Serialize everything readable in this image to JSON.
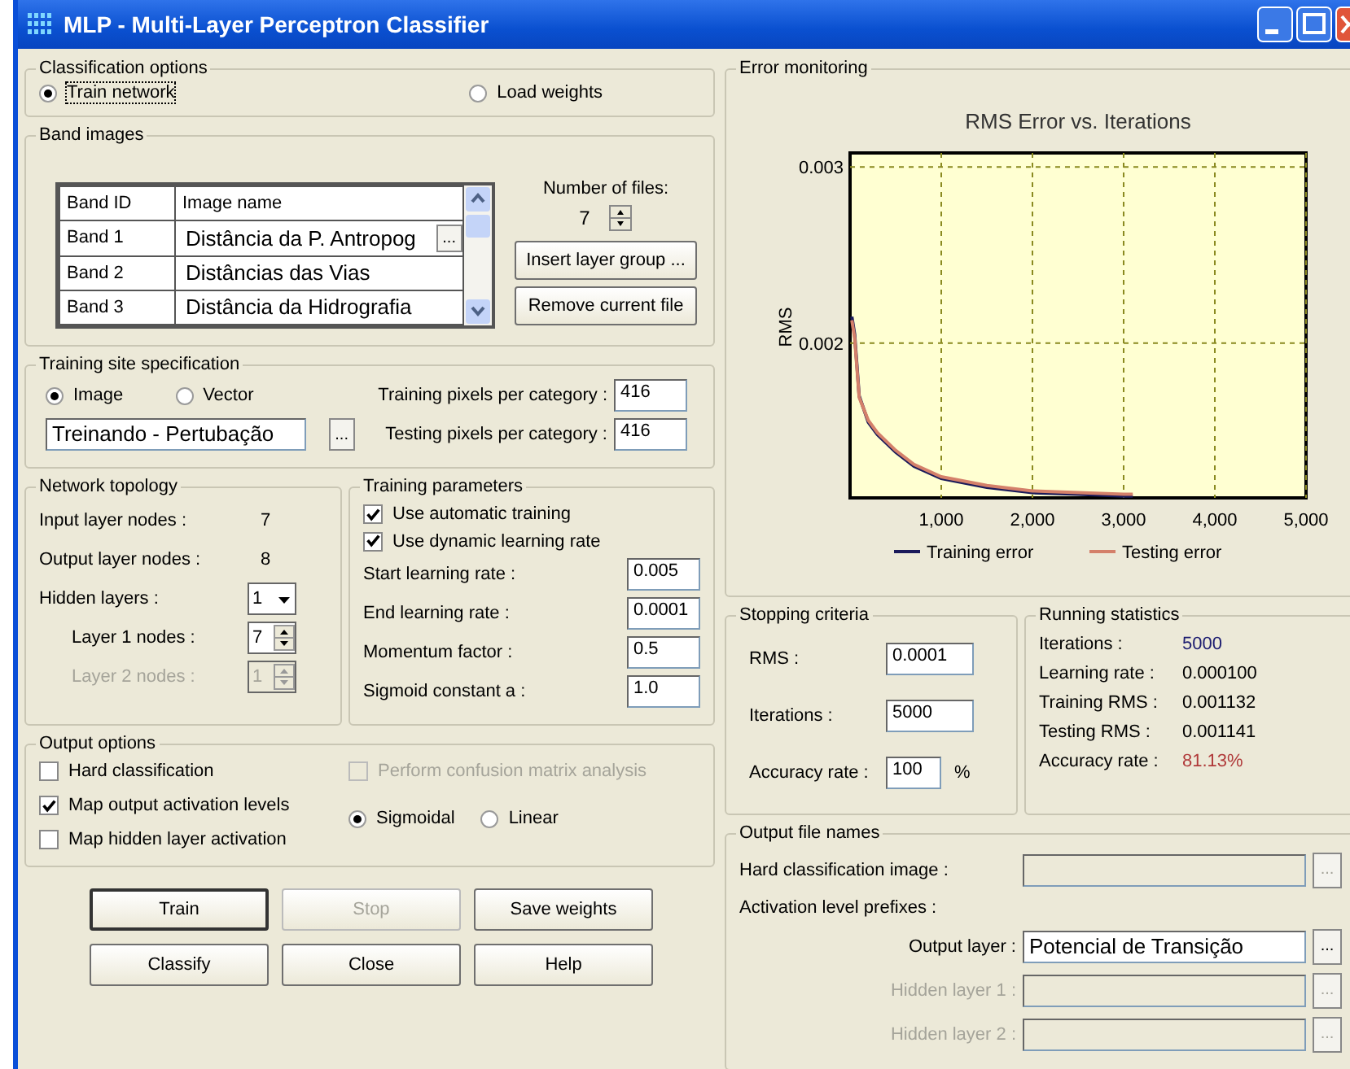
{
  "window": {
    "title": "MLP - Multi-Layer Perceptron Classifier"
  },
  "classification_options": {
    "title": "Classification options",
    "options": [
      {
        "label": "Train network",
        "selected": true
      },
      {
        "label": "Load weights",
        "selected": false
      }
    ]
  },
  "band_images": {
    "title": "Band images",
    "columns": [
      "Band ID",
      "Image name"
    ],
    "rows": [
      {
        "band": "Band 1",
        "image": "Distância da P. Antropog",
        "browse": "..."
      },
      {
        "band": "Band 2",
        "image": "Distâncias das Vias"
      },
      {
        "band": "Band 3",
        "image": "Distância da Hidrografia"
      }
    ],
    "files_label": "Number of files:",
    "files_count": "7",
    "buttons": [
      "Insert layer group ...",
      "Remove current file"
    ]
  },
  "training_site": {
    "title": "Training site specification",
    "options": [
      {
        "label": "Image",
        "selected": true
      },
      {
        "label": "Vector",
        "selected": false
      }
    ],
    "file": "Treinando - Pertubação",
    "browse": "...",
    "fields": [
      {
        "label": "Training pixels per category :",
        "value": "416"
      },
      {
        "label": "Testing pixels per category :",
        "value": "416"
      }
    ]
  },
  "network_topology": {
    "title": "Network topology",
    "rows": [
      {
        "kind": "text",
        "label": "Input layer nodes :",
        "value": "7",
        "disabled": false
      },
      {
        "kind": "text",
        "label": "Output layer nodes :",
        "value": "8",
        "disabled": false
      },
      {
        "kind": "dropdown",
        "label": "Hidden layers :",
        "value": "1",
        "disabled": false
      },
      {
        "kind": "spinner",
        "label": "Layer 1 nodes :",
        "value": "7",
        "disabled": false
      },
      {
        "kind": "spinner",
        "label": "Layer 2 nodes :",
        "value": "1",
        "disabled": true
      }
    ]
  },
  "training_parameters": {
    "title": "Training parameters",
    "checks": [
      {
        "label": "Use automatic training",
        "checked": true
      },
      {
        "label": "Use dynamic learning rate",
        "checked": true
      }
    ],
    "fields": [
      {
        "label": "Start learning rate :",
        "value": "0.005"
      },
      {
        "label": "End learning rate :",
        "value": "0.0001"
      },
      {
        "label": "Momentum factor :",
        "value": "0.5"
      },
      {
        "label": "Sigmoid constant a :",
        "value": "1.0"
      }
    ]
  },
  "output_options": {
    "title": "Output options",
    "checks": [
      {
        "label": "Hard classification",
        "checked": false,
        "disabled": false
      },
      {
        "label": "Map output activation levels",
        "checked": true,
        "disabled": false
      },
      {
        "label": "Map hidden layer activation",
        "checked": false,
        "disabled": false
      },
      {
        "label": "Perform confusion matrix analysis",
        "checked": false,
        "disabled": true
      }
    ],
    "activation": [
      {
        "label": "Sigmoidal",
        "selected": true
      },
      {
        "label": "Linear",
        "selected": false
      }
    ]
  },
  "buttons": [
    {
      "label": "Train",
      "default": true,
      "disabled": false
    },
    {
      "label": "Stop",
      "default": false,
      "disabled": true
    },
    {
      "label": "Save weights",
      "default": false,
      "disabled": false
    },
    {
      "label": "Classify",
      "default": false,
      "disabled": false
    },
    {
      "label": "Close",
      "default": false,
      "disabled": false
    },
    {
      "label": "Help",
      "default": false,
      "disabled": false
    }
  ],
  "error_monitoring": {
    "title": "Error monitoring",
    "chart_data": {
      "type": "line",
      "title": "RMS Error vs. Iterations",
      "ylabel": "RMS",
      "grid": true,
      "legend": "bottom",
      "x": [
        20,
        50,
        100,
        200,
        300,
        500,
        700,
        1000,
        1500,
        2000,
        2500,
        3000,
        3100
      ],
      "series": [
        {
          "name": "Training error",
          "color": "#1a1a5a",
          "values": [
            0.00215,
            0.00205,
            0.0017,
            0.00155,
            0.00148,
            0.00138,
            0.0013,
            0.00123,
            0.00118,
            0.00115,
            0.00114,
            0.00113,
            0.00113
          ]
        },
        {
          "name": "Testing error",
          "color": "#d4806a",
          "values": [
            0.00213,
            0.00203,
            0.00169,
            0.00156,
            0.00149,
            0.00139,
            0.00131,
            0.00124,
            0.00119,
            0.00116,
            0.00115,
            0.00114,
            0.00114
          ]
        }
      ],
      "xlim": [
        0,
        5000
      ],
      "ylim": [
        0.00112,
        0.00308
      ],
      "xticks": [
        {
          "value": 1000,
          "label": "1,000"
        },
        {
          "value": 2000,
          "label": "2,000"
        },
        {
          "value": 3000,
          "label": "3,000"
        },
        {
          "value": 4000,
          "label": "4,000"
        },
        {
          "value": 5000,
          "label": "5,000"
        }
      ],
      "yticks": [
        0.002,
        0.003
      ]
    }
  },
  "stopping_criteria": {
    "title": "Stopping criteria",
    "fields": [
      {
        "label": "RMS :",
        "value": "0.0001"
      },
      {
        "label": "Iterations :",
        "value": "5000"
      },
      {
        "label": "Accuracy rate :",
        "value": "100",
        "unit": "%"
      }
    ]
  },
  "running_statistics": {
    "title": "Running statistics",
    "rows": [
      {
        "label": "Iterations :",
        "value": "5000",
        "color": "#1c1c70"
      },
      {
        "label": "Learning rate :",
        "value": "0.000100",
        "color": "#000000"
      },
      {
        "label": "Training RMS :",
        "value": "0.001132",
        "color": "#000000"
      },
      {
        "label": "Testing RMS :",
        "value": "0.001141",
        "color": "#000000"
      },
      {
        "label": "Accuracy rate :",
        "value": "81.13%",
        "color": "#b03a3a"
      }
    ]
  },
  "output_file_names": {
    "title": "Output file names",
    "rows": [
      {
        "kind": "field",
        "label": "Hard classification image :",
        "disabled": true,
        "browse": "..."
      },
      {
        "kind": "heading",
        "label": "Activation level prefixes :"
      },
      {
        "kind": "subfield",
        "label": "Output layer :",
        "value": "Potencial de Transição",
        "disabled": false,
        "browse": "..."
      },
      {
        "kind": "subfield",
        "label": "Hidden layer 1 :",
        "disabled": true,
        "browse": "..."
      },
      {
        "kind": "subfield",
        "label": "Hidden layer 2 :",
        "disabled": true,
        "browse": "..."
      }
    ]
  }
}
